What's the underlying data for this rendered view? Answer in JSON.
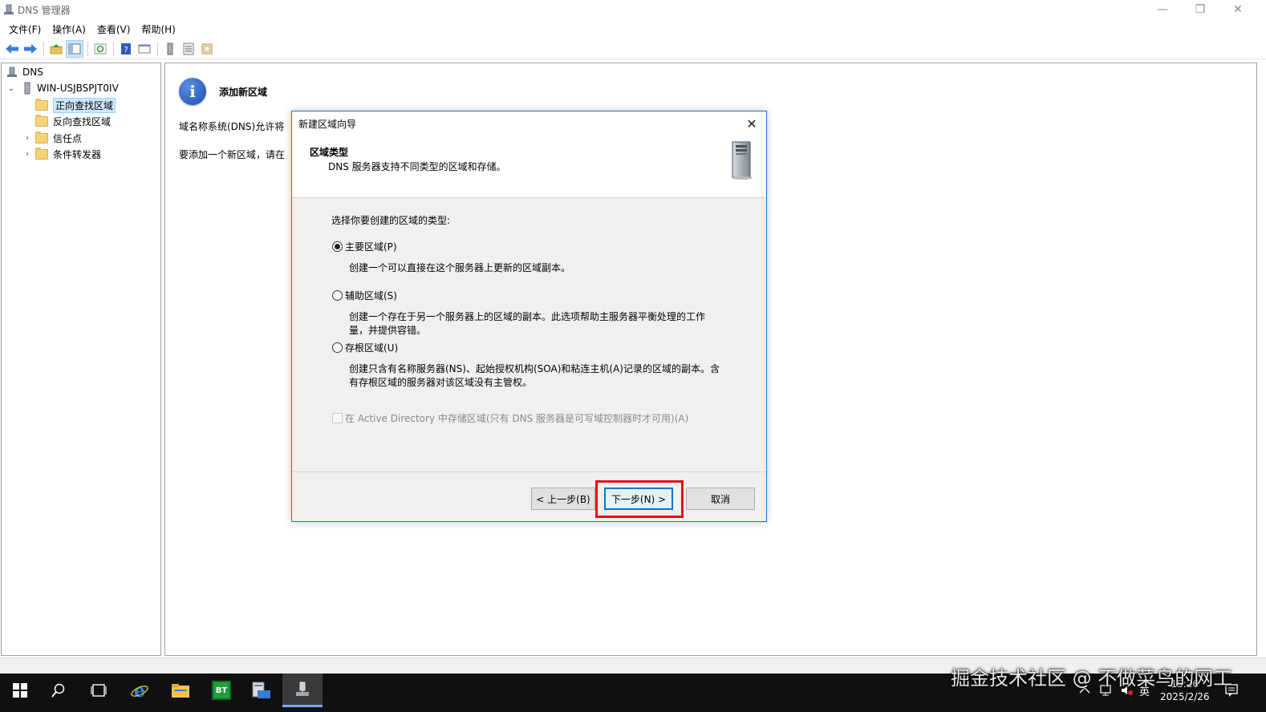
{
  "window": {
    "title": "DNS 管理器",
    "minimize": "—",
    "restore": "❐",
    "close": "✕"
  },
  "menu": [
    "文件(F)",
    "操作(A)",
    "查看(V)",
    "帮助(H)"
  ],
  "tree": {
    "root": "DNS",
    "server": "WIN-USJBSPJT0IV",
    "items": [
      "正向查找区域",
      "反向查找区域",
      "信任点",
      "条件转发器"
    ]
  },
  "rightpane": {
    "title": "添加新区域",
    "line1": "域名称系统(DNS)允许将",
    "line2": "要添加一个新区域，请在"
  },
  "dialog": {
    "title": "新建区域向导",
    "close": "✕",
    "header_title": "区域类型",
    "header_subtitle": "DNS 服务器支持不同类型的区域和存储。",
    "prompt": "选择你要创建的区域的类型:",
    "options": [
      {
        "label": "主要区域(P)",
        "desc1": "创建一个可以直接在这个服务器上更新的区域副本。",
        "desc2": "",
        "checked": true
      },
      {
        "label": "辅助区域(S)",
        "desc1": "创建一个存在于另一个服务器上的区域的副本。此选项帮助主服务器平衡处理的工作",
        "desc2": "量，并提供容错。",
        "checked": false
      },
      {
        "label": "存根区域(U)",
        "desc1": "创建只含有名称服务器(NS)、起始授权机构(SOA)和粘连主机(A)记录的区域的副本。含",
        "desc2": "有存根区域的服务器对该区域没有主管权。",
        "checked": false
      }
    ],
    "ad_checkbox": "在 Active Directory 中存储区域(只有 DNS 服务器是可写域控制器时才可用)(A)",
    "btn_back": "< 上一步(B)",
    "btn_next": "下一步(N) >",
    "btn_cancel": "取消"
  },
  "taskbar": {
    "bt_label": "BT",
    "ime": "英",
    "time": "15:26",
    "date": "2025/2/26"
  },
  "watermark": "掘金技术社区 @ 不做菜鸟的网工"
}
